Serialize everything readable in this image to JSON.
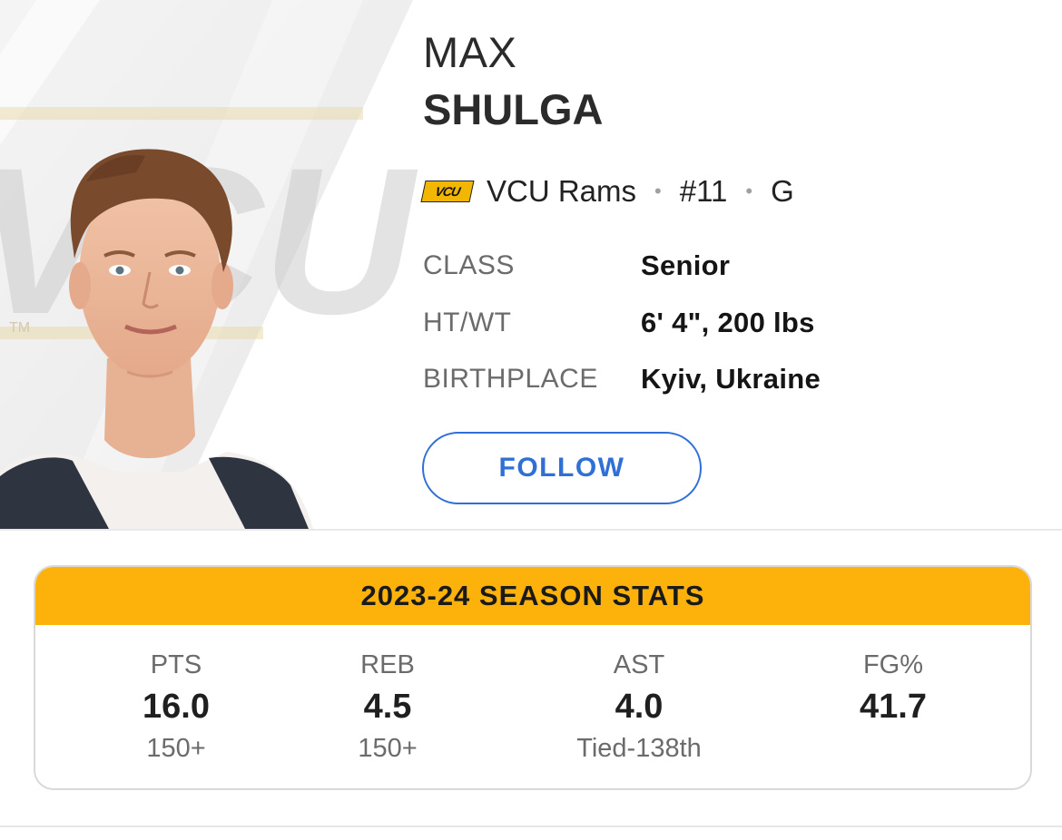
{
  "player": {
    "first_name": "MAX",
    "last_name": "SHULGA",
    "team_name": "VCU Rams",
    "team_logo_text": "VCU",
    "number": "#11",
    "position": "G",
    "separator": "•"
  },
  "info": [
    {
      "label": "CLASS",
      "value": "Senior"
    },
    {
      "label": "HT/WT",
      "value": "6' 4\", 200 lbs"
    },
    {
      "label": "BIRTHPLACE",
      "value": "Kyiv, Ukraine"
    }
  ],
  "follow_label": "FOLLOW",
  "stats": {
    "title": "2023-24 SEASON STATS",
    "items": [
      {
        "label": "PTS",
        "value": "16.0",
        "rank": "150+"
      },
      {
        "label": "REB",
        "value": "4.5",
        "rank": "150+"
      },
      {
        "label": "AST",
        "value": "4.0",
        "rank": "Tied-138th"
      },
      {
        "label": "FG%",
        "value": "41.7",
        "rank": ""
      }
    ]
  },
  "colors": {
    "accent_blue": "#2f6fd6",
    "stats_header_gold": "#fdb10b"
  },
  "photo_logo_text": "VCU",
  "photo_trademark": "TM"
}
